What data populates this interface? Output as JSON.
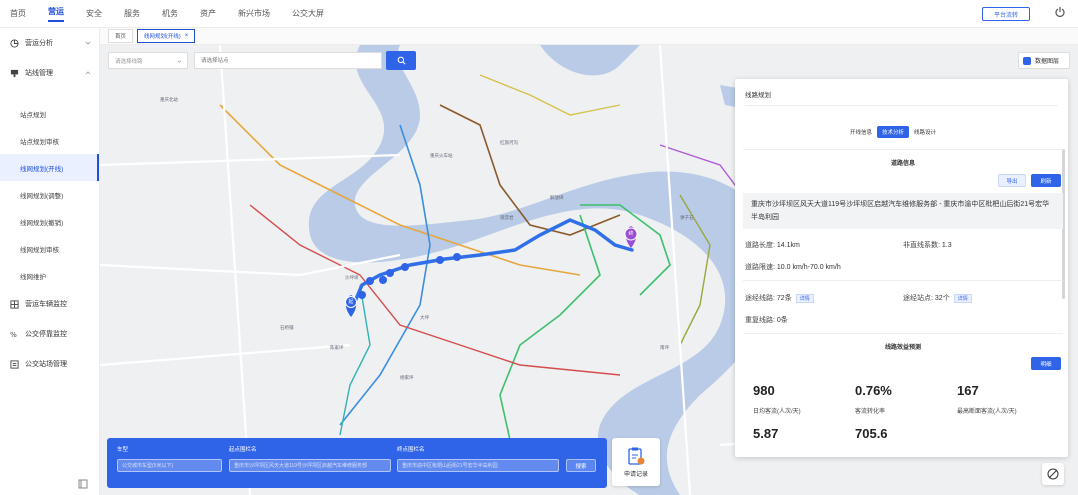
{
  "topnav": {
    "items": [
      "首页",
      "营运",
      "安全",
      "服务",
      "机务",
      "资产",
      "新兴市场",
      "公交大屏"
    ],
    "active_index": 1,
    "platform_button": "平台流转"
  },
  "sidebar": {
    "groups": [
      {
        "label": "营运分析",
        "icon": "chart-icon",
        "expanded": false
      },
      {
        "label": "站线管理",
        "icon": "station-icon",
        "expanded": true
      }
    ],
    "subitems": [
      "站点规划",
      "站点规划审核",
      "线网规划(开线)",
      "线网规划(调整)",
      "线网规划(撤销)",
      "线网规划审核",
      "线网维护"
    ],
    "active_subitem": 2,
    "more_groups": [
      {
        "label": "营运车辆监控",
        "icon": "bus-monitor-icon"
      },
      {
        "label": "公交停靠监控",
        "icon": "stop-monitor-icon"
      },
      {
        "label": "公交站场管理",
        "icon": "depot-icon"
      }
    ]
  },
  "tabs": [
    {
      "label": "首页",
      "active": false
    },
    {
      "label": "线网规划(开线)",
      "active": true,
      "closable": true
    }
  ],
  "map": {
    "select_placeholder": "请选择线路",
    "search_placeholder": "请选择站点",
    "layer_button": "数据图层",
    "origin_marker": "起",
    "dest_marker": "终",
    "labels": [
      "重庆北站",
      "重庆火车站",
      "沙坪坝",
      "解放碑",
      "南坪",
      "观音岩",
      "杨家坪",
      "大坪",
      "石桥铺",
      "陈家坪",
      "红旗河沟",
      "弹子石"
    ],
    "route_color": "#2f6fe8"
  },
  "query": {
    "vehicle_label": "车型",
    "vehicle_placeholder": "公交城市车型(5米以下)",
    "start_label": "起点围栏名",
    "start_placeholder": "重庆市沙坪坝区风天大道119号沙坪坝区启越汽车维修服务部",
    "end_label": "终点围栏名",
    "end_placeholder": "重庆市渝中区枇杷山后街21号宏华半岛利园",
    "search_button": "搜索",
    "apply_label": "申请记录"
  },
  "panel": {
    "title": "线路规划",
    "segments": [
      "开线信息",
      "技术分析",
      "线路设计"
    ],
    "active_segment": 1,
    "route_info_title": "道路信息",
    "export_button": "导出",
    "refresh_button": "刷新",
    "address": "重庆市沙坪坝区风天大道119号沙坪坝区启越汽车维修服务部 - 重庆市渝中区枇杷山后街21号宏华半岛利园",
    "road_length_label": "道路长度:",
    "road_length": "14.1km",
    "nonlinear_label": "非直线系数:",
    "nonlinear": "1.3",
    "speed_label": "道路限速:",
    "speed": "10.0 km/h-70.0 km/h",
    "via_lines_label": "途经线路:",
    "via_lines": "72条",
    "via_stops_label": "途经站点:",
    "via_stops": "32个",
    "detail_button": "详情",
    "overlap_label": "重复线路:",
    "overlap": "0条",
    "forecast_title": "线路效益预测",
    "forecast_button": "明细",
    "metrics": [
      {
        "value": "980",
        "label": "日均客流(人次/天)"
      },
      {
        "value": "0.76%",
        "label": "客流转化率"
      },
      {
        "value": "167",
        "label": "最高断面客流(人次/天)"
      },
      {
        "value": "5.87",
        "label": ""
      },
      {
        "value": "705.6",
        "label": ""
      }
    ]
  }
}
